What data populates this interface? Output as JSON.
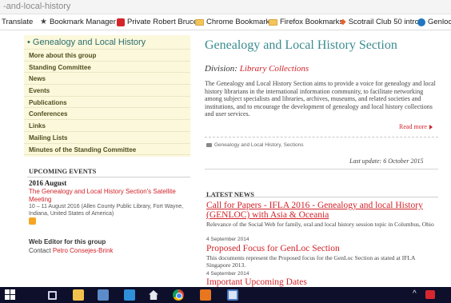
{
  "browser": {
    "url_fragment": "-and-local-history",
    "bookmarks": [
      {
        "label": "Translate",
        "icon": "none"
      },
      {
        "label": "Bookmark Manager",
        "icon": "star-icon"
      },
      {
        "label": "Private Robert Bruce",
        "icon": "red-square-icon"
      },
      {
        "label": "Chrome Bookmarks",
        "icon": "folder-icon"
      },
      {
        "label": "Firefox Bookmarks",
        "icon": "folder-icon"
      },
      {
        "label": "Scotrail Club 50 intro",
        "icon": "scotrail-icon"
      },
      {
        "label": "Genloc b",
        "icon": "wordpress-icon"
      }
    ]
  },
  "sidebar": {
    "heading": "• Genealogy and Local History",
    "items": [
      {
        "label": "More about this group"
      },
      {
        "label": "Standing Committee"
      },
      {
        "label": "News"
      },
      {
        "label": "Events"
      },
      {
        "label": "Publications"
      },
      {
        "label": "Conferences"
      },
      {
        "label": "Links"
      },
      {
        "label": "Mailing Lists"
      },
      {
        "label": "Minutes of the Standing Committee"
      }
    ]
  },
  "events": {
    "heading": "UPCOMING EVENTS",
    "date": "2016 August",
    "title": "The Genealogy and Local History Section's Satellite Meeting",
    "description": "10 – 11 August 2016 (Allen County Public Library, Fort Wayne, Indiana, United States of America)"
  },
  "web_editor": {
    "heading": "Web Editor for this group",
    "contact_label": "Contact",
    "contact_name": "Petro Consejes-Brink"
  },
  "main": {
    "title": "Genealogy and Local History Section",
    "division_label": "Division:",
    "division_value": "Library Collections",
    "intro": "The Genealogy and Local History Section aims to provide a voice for genealogy and local history librarians in the international information community, to facilitate networking among subject specialists and libraries, archives, museums, and related societies and institutions, and to encourage the development of genealogy and local history collections and user services.",
    "read_more": "Read more",
    "tags": "Genealogy and Local History, Sections",
    "last_update": "Last update: 6 October 2015"
  },
  "news": {
    "heading": "LATEST NEWS",
    "items": [
      {
        "title": "Call for Papers - IFLA 2016 - Genealogy and local History (GENLOC) with Asia & Oceania",
        "text": "Relevance of the Social Web for family, oral and local history session topic in Columbus, Ohio",
        "date": "4 September 2014"
      },
      {
        "title": "Proposed Focus for GenLoc Section",
        "text": "This documents represent the Proposed focus for the GenLoc Section as stated at IFLA Singapore 2013.",
        "date": "4 September 2014"
      },
      {
        "title": "Important Upcoming Dates",
        "text": "",
        "date": ""
      }
    ]
  },
  "taskbar": {
    "tray_chevron": "^"
  },
  "colors": {
    "accent_teal": "#3a8b8e",
    "link_red": "#d1232a",
    "sidebar_bg": "#fbf8dc",
    "taskbar_bg": "#0d0f2b"
  }
}
